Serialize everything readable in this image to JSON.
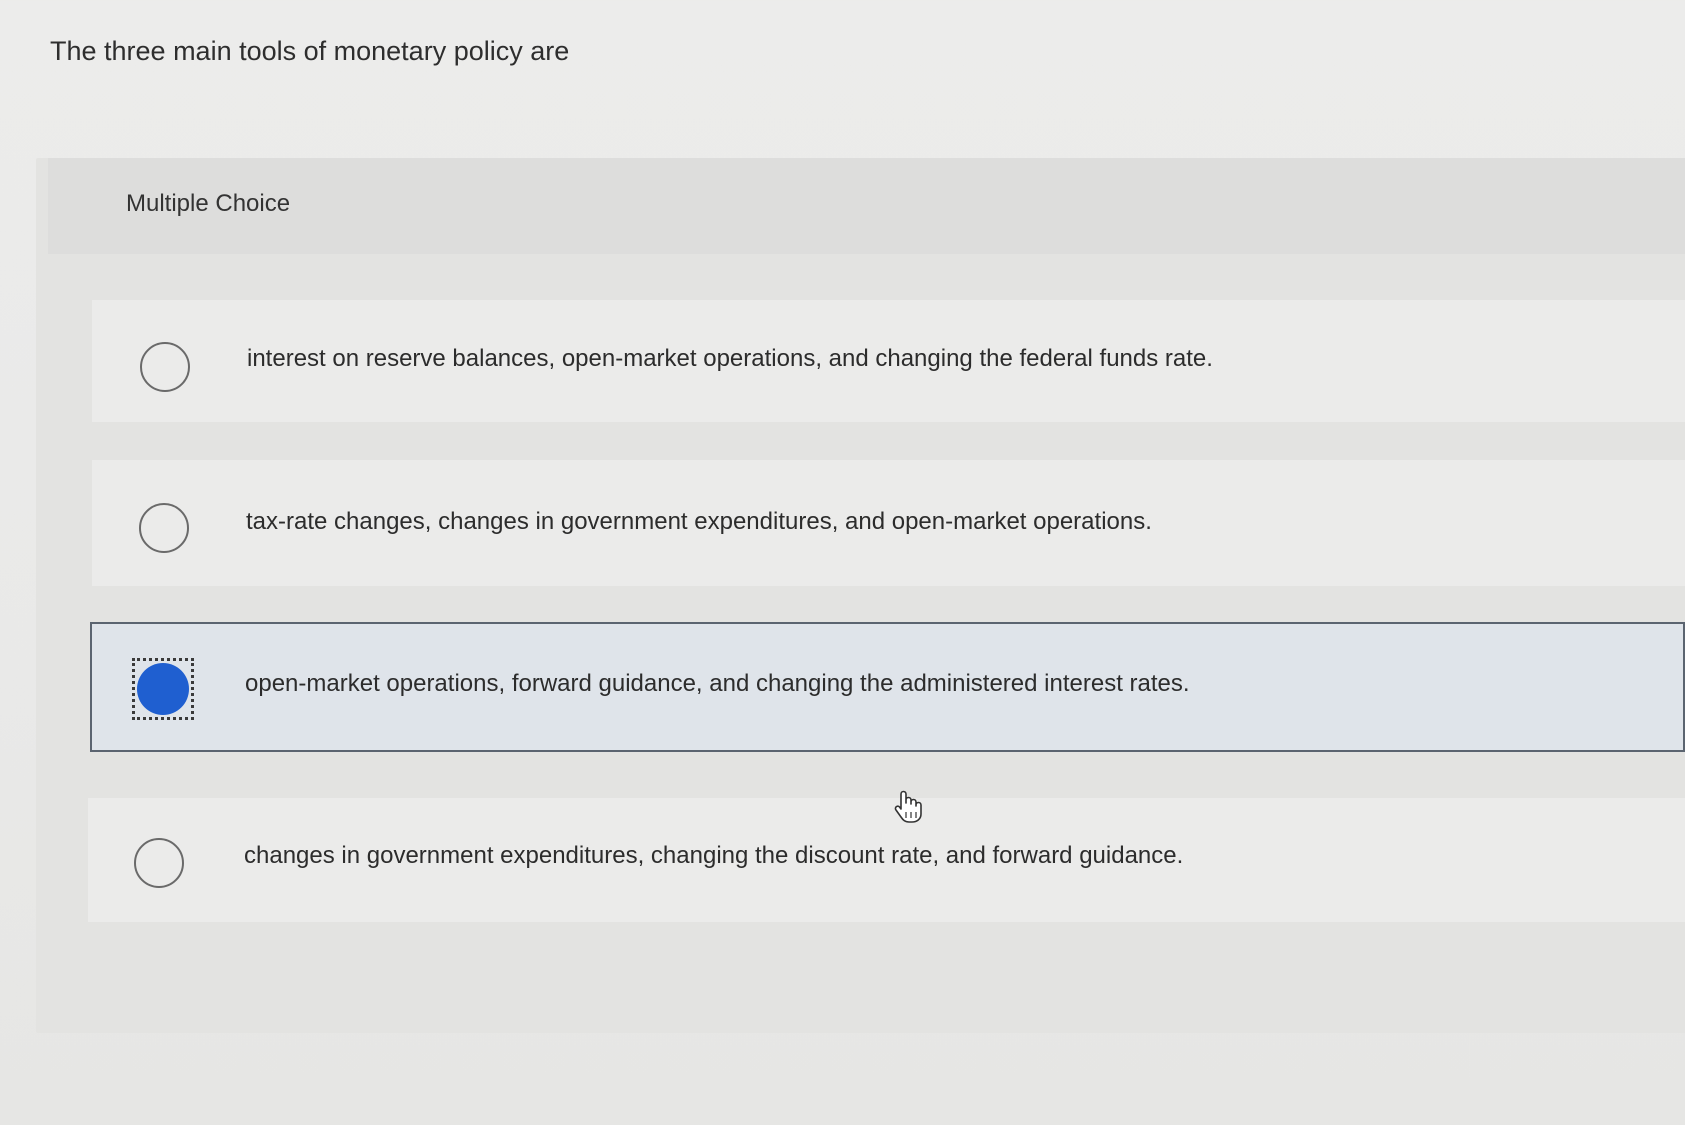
{
  "question": {
    "text": "The three main tools of monetary policy are"
  },
  "panel": {
    "type_label": "Multiple Choice"
  },
  "choices": [
    {
      "text": "interest on reserve balances, open-market operations, and changing the federal funds rate.",
      "selected": false
    },
    {
      "text": "tax-rate changes, changes in government expenditures, and open-market operations.",
      "selected": false
    },
    {
      "text": "open-market operations, forward guidance, and changing the administered interest rates.",
      "selected": true
    },
    {
      "text": "changes in government expenditures, changing the discount rate, and forward guidance.",
      "selected": false
    }
  ],
  "colors": {
    "selected_radio": "#1f5fd0",
    "selected_background": "#dfe4ea",
    "selected_border": "#5b6470"
  },
  "icons": {
    "cursor": "hand-pointer-icon"
  }
}
